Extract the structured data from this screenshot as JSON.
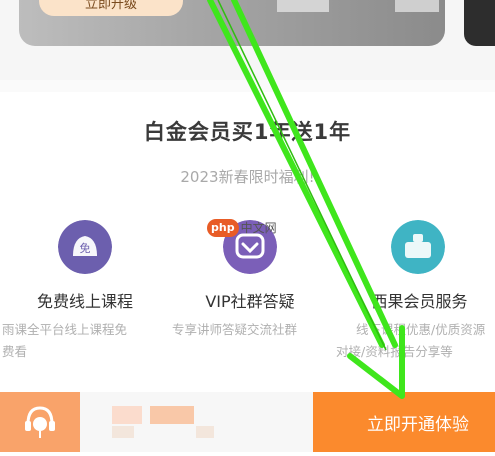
{
  "banner": {
    "button_label": "立即升级"
  },
  "promo": {
    "title": "白金会员买1年送1年",
    "subtitle": "2023新春限时福利!"
  },
  "benefits": [
    {
      "label": "免费线上课程",
      "desc_line1": "雨课全平台线上课程免",
      "desc_line2": "费看",
      "icon": "free-badge-icon",
      "icon_text": "免",
      "icon_color": "#6c5fae"
    },
    {
      "label": "VIP社群答疑",
      "desc_line1": "专享讲师答疑交流社群",
      "desc_line2": "",
      "icon": "heart-chat-icon",
      "icon_color": "#7b5fb8"
    },
    {
      "label": "西果会员服务",
      "desc_line1": "线下课程优惠/优质资源",
      "desc_line2": "对接/资料报告分享等",
      "icon": "gift-voucher-icon",
      "icon_color": "#3fb4c4"
    }
  ],
  "watermark": {
    "badge": "php",
    "text": "中文网"
  },
  "bottom_bar": {
    "service_icon": "customer-service-icon",
    "open_button_label": "立即开通",
    "open_button_suffix": "体验"
  },
  "colors": {
    "accent_orange": "#fb8a2d",
    "service_orange": "#f9a36a",
    "annotation_green": "#3fe61c"
  }
}
